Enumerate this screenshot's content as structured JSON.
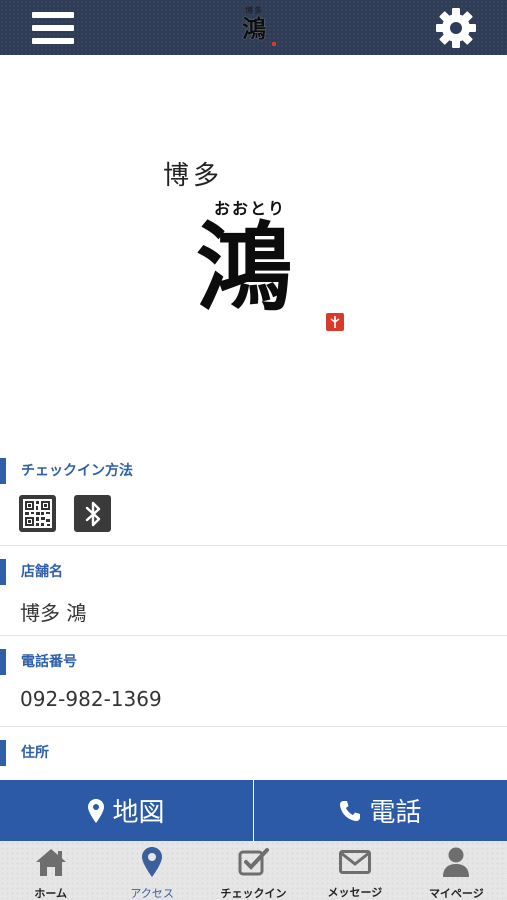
{
  "header": {
    "logo_small": "博多",
    "logo_big": "鴻"
  },
  "logo": {
    "line1": "博多",
    "line2": "おおとり",
    "main": "鴻"
  },
  "sections": {
    "checkin": {
      "label": "チェックイン方法"
    },
    "store": {
      "label": "店舗名",
      "value": "博多 鴻"
    },
    "phone": {
      "label": "電話番号",
      "value": "092-982-1369"
    },
    "address": {
      "label": "住所"
    }
  },
  "actions": {
    "map_label": "地図",
    "call_label": "電話"
  },
  "tabs": [
    {
      "label": "ホーム",
      "icon": "home-icon"
    },
    {
      "label": "アクセス",
      "icon": "map-pin-icon",
      "active": true
    },
    {
      "label": "チェックイン",
      "icon": "checkbox-icon"
    },
    {
      "label": "メッセージ",
      "icon": "envelope-icon"
    },
    {
      "label": "マイページ",
      "icon": "user-icon"
    }
  ],
  "colors": {
    "header_bg": "#2f3c56",
    "accent": "#2e5fa8",
    "action_bg": "#2c5aa6",
    "tab_bg": "#e6e6e6",
    "stamp_red": "#d93a2c"
  }
}
